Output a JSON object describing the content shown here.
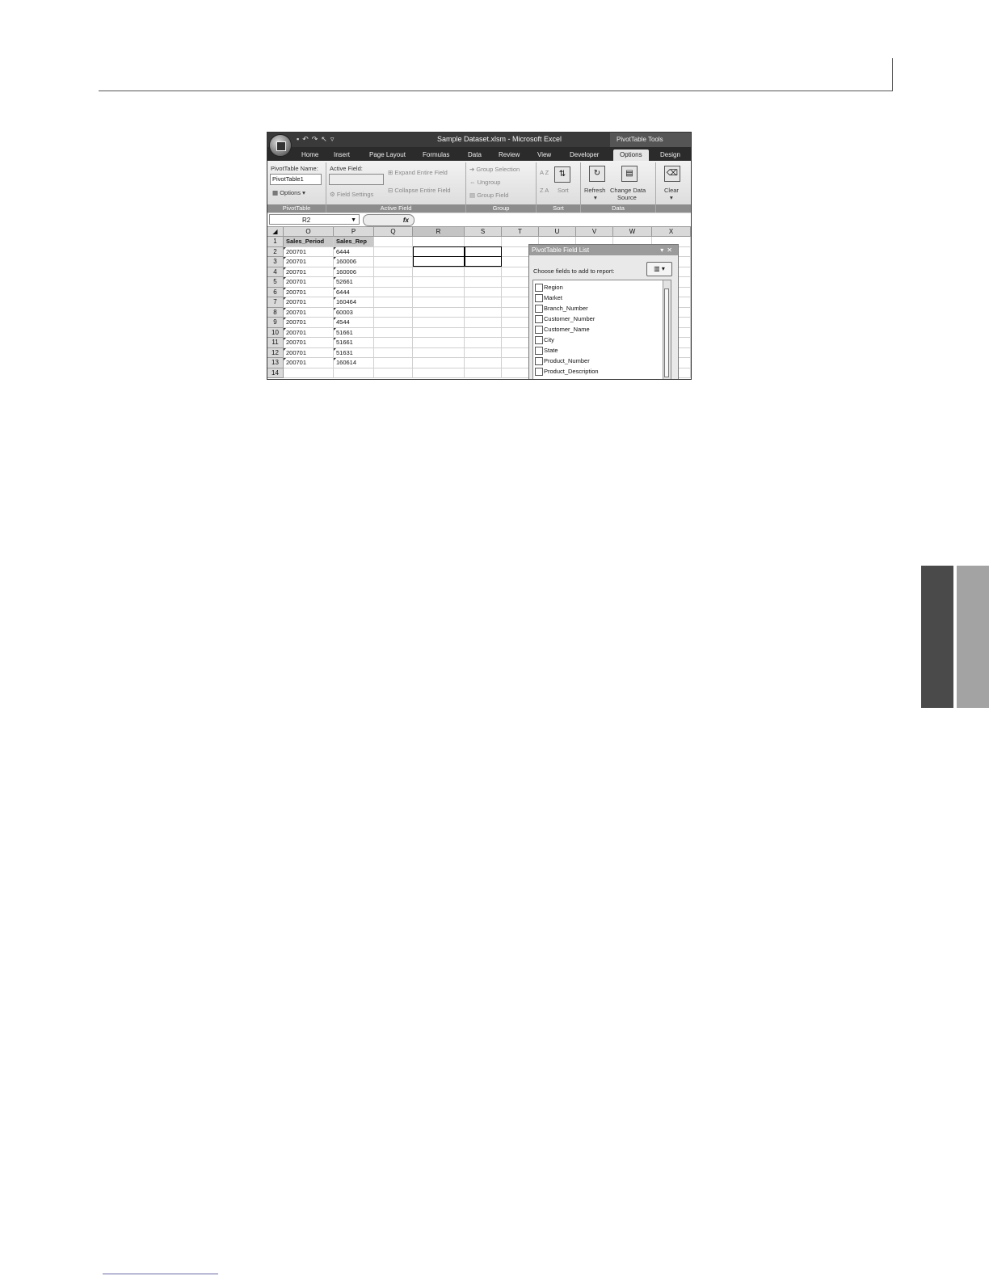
{
  "window": {
    "title": "Sample Dataset.xlsm - Microsoft Excel",
    "contextual_tab_group": "PivotTable Tools"
  },
  "tabs": [
    "Home",
    "Insert",
    "Page Layout",
    "Formulas",
    "Data",
    "Review",
    "View",
    "Developer",
    "Options",
    "Design"
  ],
  "active_tab": "Options",
  "ribbon": {
    "pivottable": {
      "name_label": "PivotTable Name:",
      "name_value": "PivotTable1",
      "options_label": "Options",
      "group_label": "PivotTable"
    },
    "active_field": {
      "label": "Active Field:",
      "field_settings": "Field Settings",
      "expand": "Expand Entire Field",
      "collapse": "Collapse Entire Field",
      "group_label": "Active Field"
    },
    "group": {
      "group_selection": "Group Selection",
      "ungroup": "Ungroup",
      "group_field": "Group Field",
      "group_label": "Group"
    },
    "sort": {
      "sort_label": "Sort",
      "az": "A Z",
      "za": "Z A",
      "group_label": "Sort"
    },
    "data": {
      "refresh": "Refresh",
      "change_data": "Change Data",
      "source": "Source",
      "group_label": "Data"
    },
    "clear": "Clear"
  },
  "formula_bar": {
    "name_box": "R2",
    "fx": "fx"
  },
  "columns": [
    "O",
    "P",
    "Q",
    "R",
    "S",
    "T",
    "U",
    "V",
    "W",
    "X"
  ],
  "rows": [
    "1",
    "2",
    "3",
    "4",
    "5",
    "6",
    "7",
    "8",
    "9",
    "10",
    "11",
    "12",
    "13",
    "14"
  ],
  "headers": [
    "Sales_Period",
    "Sales_Rep"
  ],
  "sales_period": [
    "200701",
    "200701",
    "200701",
    "200701",
    "200701",
    "200701",
    "200701",
    "200701",
    "200701",
    "200701",
    "200701",
    "200701"
  ],
  "sales_rep": [
    "6444",
    "160006",
    "160006",
    "52661",
    "6444",
    "160464",
    "60003",
    "4544",
    "51661",
    "51661",
    "51631",
    "160614"
  ],
  "field_list": {
    "title": "PivotTable Field List",
    "choose_label": "Choose fields to add to report:",
    "fields": [
      "Region",
      "Market",
      "Branch_Number",
      "Customer_Number",
      "Customer_Name",
      "City",
      "State",
      "Product_Number",
      "Product_Description"
    ]
  }
}
